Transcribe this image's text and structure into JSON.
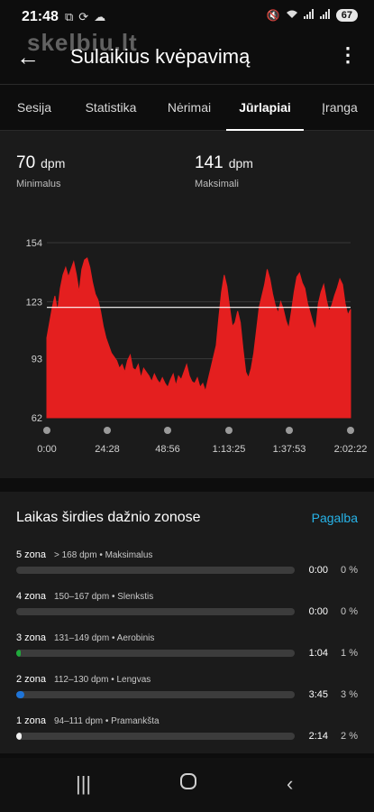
{
  "status_bar": {
    "time": "21:48",
    "left_icons": [
      "screenshot-icon",
      "sync-icon",
      "cloud-icon"
    ],
    "right_icons": [
      "mute-icon",
      "wifi-icon",
      "signal-icon",
      "signal-icon"
    ],
    "battery": "67"
  },
  "watermark": "skelbiu.lt",
  "app_bar": {
    "title": "Sulaikius kvėpavimą"
  },
  "tabs": [
    {
      "label": "Sesija"
    },
    {
      "label": "Statistika"
    },
    {
      "label": "Nėrimai"
    },
    {
      "label": "Jūrlapiai",
      "active": true
    },
    {
      "label": "Įranga"
    }
  ],
  "heart_stats": {
    "min": {
      "value": "70",
      "unit": "dpm",
      "label": "Minimalus"
    },
    "max": {
      "value": "141",
      "unit": "dpm",
      "label": "Maksimali"
    }
  },
  "chart_data": {
    "type": "area",
    "y_ticks": [
      "154",
      "123",
      "93",
      "62"
    ],
    "ylim": [
      62,
      154
    ],
    "x_ticks": [
      "0:00",
      "24:28",
      "48:56",
      "1:13:25",
      "1:37:53",
      "2:02:22"
    ],
    "xlim_seconds": [
      0,
      7342
    ],
    "reference_line": 120,
    "series_color": "#e41f1f",
    "series": [
      {
        "values": [
          104,
          112,
          120,
          126,
          118,
          130,
          137,
          141,
          136,
          140,
          144,
          137,
          128,
          140,
          145,
          146,
          141,
          133,
          127,
          124,
          118,
          110,
          104,
          100,
          96,
          94,
          92,
          88,
          90,
          86,
          92,
          95,
          88,
          87,
          90,
          83,
          88,
          86,
          84,
          81,
          85,
          82,
          80,
          83,
          80,
          78,
          82,
          85,
          79,
          84,
          82,
          86,
          90,
          84,
          81,
          80,
          83,
          78,
          80,
          76,
          82,
          88,
          94,
          100,
          115,
          128,
          137,
          131,
          120,
          110,
          112,
          118,
          112,
          98,
          86,
          83,
          88,
          96,
          108,
          120,
          126,
          132,
          140,
          135,
          127,
          121,
          117,
          123,
          119,
          113,
          109,
          118,
          128,
          136,
          138,
          133,
          130,
          122,
          117,
          112,
          108,
          122,
          128,
          132,
          124,
          118,
          121,
          126,
          130,
          135,
          132,
          122,
          116,
          119
        ]
      }
    ]
  },
  "zones_card": {
    "title": "Laikas širdies dažnio zonose",
    "help_link": "Pagalba",
    "zones": [
      {
        "name": "5 zona",
        "desc": "> 168 dpm • Maksimalus",
        "time": "0:00",
        "percent": "0 %",
        "fill": 0,
        "color": "#9c27b0"
      },
      {
        "name": "4 zona",
        "desc": "150–167 dpm • Slenkstis",
        "time": "0:00",
        "percent": "0 %",
        "fill": 0,
        "color": "#ff5722"
      },
      {
        "name": "3 zona",
        "desc": "131–149 dpm • Aerobinis",
        "time": "1:04",
        "percent": "1 %",
        "fill": 1,
        "color": "#1faa3b"
      },
      {
        "name": "2 zona",
        "desc": "112–130 dpm • Lengvas",
        "time": "3:45",
        "percent": "3 %",
        "fill": 3,
        "color": "#1e74d8"
      },
      {
        "name": "1 zona",
        "desc": "94–111 dpm • Pramankšta",
        "time": "2:14",
        "percent": "2 %",
        "fill": 2,
        "color": "#f0f0f0"
      }
    ]
  },
  "nav_bar": {
    "icons": [
      "recent-apps-icon",
      "home-icon",
      "back-icon"
    ]
  }
}
